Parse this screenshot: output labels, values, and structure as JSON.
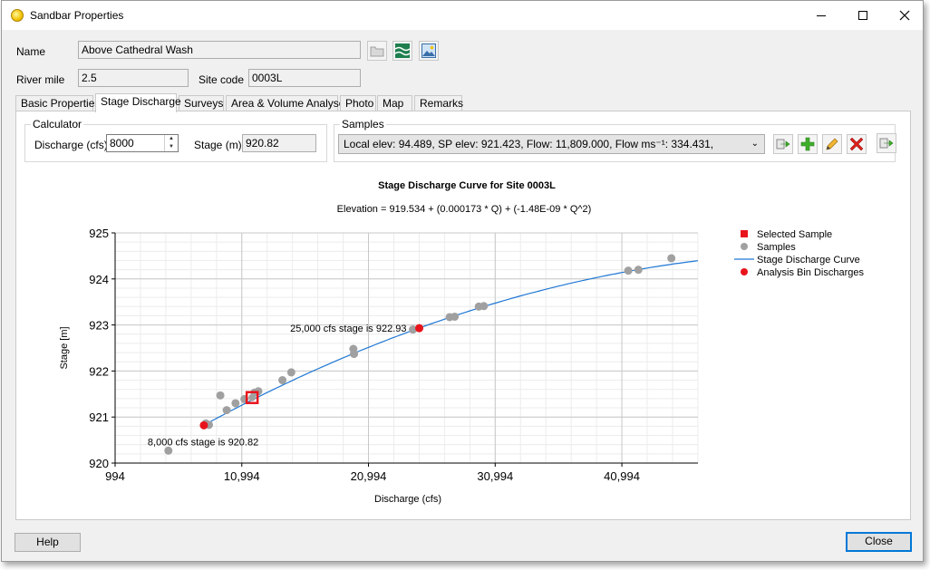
{
  "window": {
    "title": "Sandbar Properties"
  },
  "form": {
    "name_label": "Name",
    "name_value": "Above Cathedral Wash",
    "river_mile_label": "River mile",
    "river_mile_value": "2.5",
    "site_code_label": "Site code",
    "site_code_value": "0003L"
  },
  "tabs": [
    {
      "label": "Basic Properties"
    },
    {
      "label": "Stage Discharge",
      "active": true
    },
    {
      "label": "Surveys"
    },
    {
      "label": "Area & Volume Analyses"
    },
    {
      "label": "Photo"
    },
    {
      "label": "Map"
    },
    {
      "label": "Remarks"
    }
  ],
  "calculator": {
    "title": "Calculator",
    "discharge_label": "Discharge (cfs)",
    "discharge_value": "8000",
    "stage_label": "Stage (m)",
    "stage_value": "920.82"
  },
  "samples": {
    "title": "Samples",
    "selected": "Local elev: 94.489, SP elev: 921.423, Flow: 11,809.000, Flow ms⁻¹: 334.431,"
  },
  "buttons": {
    "help": "Help",
    "close": "Close"
  },
  "icons": {
    "app": "sun-icon",
    "toolbar": [
      "folder-icon",
      "river-icon",
      "image-icon"
    ],
    "samples": [
      "export-icon",
      "add-icon",
      "edit-icon",
      "delete-icon",
      "export-all-icon"
    ]
  },
  "colors": {
    "curve": "#1f77d4",
    "sample": "#a0a0a0",
    "selected": "#e8141c",
    "bin": "#e8141c"
  },
  "chart_data": {
    "type": "scatter",
    "title": "Stage Discharge Curve for Site 0003L",
    "subtitle": "Elevation = 919.534 + (0.000173 * Q) + (-1.48E-09 * Q^2)",
    "xlabel": "Discharge (cfs)",
    "ylabel": "Stage [m]",
    "xlim": [
      994,
      47000
    ],
    "ylim": [
      920,
      925
    ],
    "xticks": [
      "994",
      "10,994",
      "20,994",
      "30,994",
      "40,994"
    ],
    "yticks": [
      "920",
      "921",
      "922",
      "923",
      "924",
      "925"
    ],
    "grid": true,
    "legend_position": "right",
    "legend": [
      "Selected Sample",
      "Samples",
      "Stage Discharge Curve",
      "Analysis Bin Discharges"
    ],
    "curve": {
      "name": "Stage Discharge Curve",
      "a": 919.534,
      "b": 0.000173,
      "c": -1.48e-09,
      "x_range": [
        8000,
        47000
      ]
    },
    "samples": {
      "name": "Samples",
      "points": [
        [
          5200,
          920.27
        ],
        [
          8150,
          920.86
        ],
        [
          8400,
          920.83
        ],
        [
          9300,
          921.47
        ],
        [
          9800,
          921.15
        ],
        [
          10500,
          921.3
        ],
        [
          11200,
          921.39
        ],
        [
          12000,
          921.53
        ],
        [
          12300,
          921.56
        ],
        [
          14200,
          921.8
        ],
        [
          14900,
          921.97
        ],
        [
          19800,
          922.48
        ],
        [
          19850,
          922.37
        ],
        [
          24500,
          922.9
        ],
        [
          27400,
          923.17
        ],
        [
          27800,
          923.18
        ],
        [
          29700,
          923.4
        ],
        [
          30100,
          923.41
        ],
        [
          41500,
          924.18
        ],
        [
          42300,
          924.2
        ],
        [
          44900,
          924.45
        ]
      ]
    },
    "selected_sample": {
      "name": "Selected Sample",
      "x": 11809,
      "y": 921.423
    },
    "analysis_bins": {
      "name": "Analysis Bin Discharges",
      "points": [
        [
          8000,
          920.82
        ],
        [
          25000,
          922.93
        ]
      ]
    },
    "annotations": [
      {
        "text": "8,000 cfs stage is 920.82",
        "x": 8000,
        "y": 920.82
      },
      {
        "text": "25,000 cfs stage is 922.93",
        "x": 25000,
        "y": 922.93
      }
    ]
  }
}
